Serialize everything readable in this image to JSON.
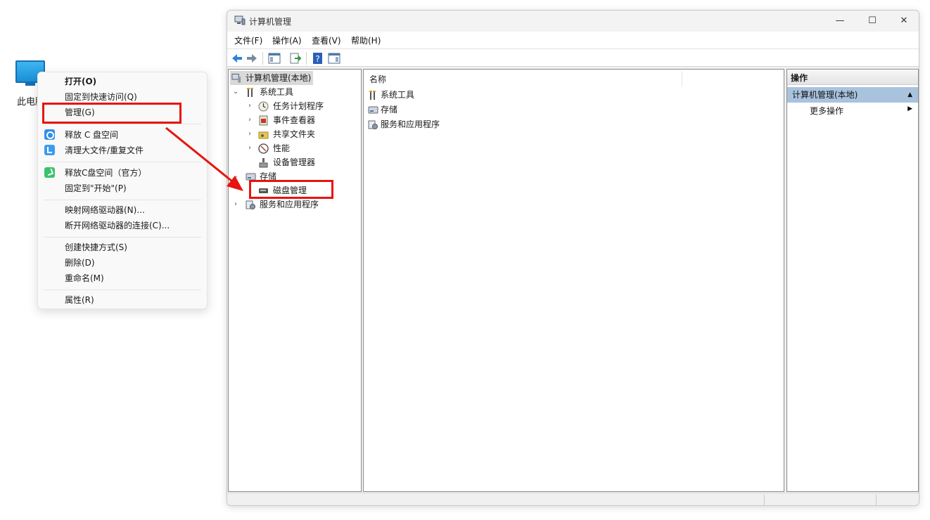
{
  "desktop": {
    "icon_label": "此电脑"
  },
  "context_menu": {
    "items": [
      {
        "label": "打开(O)",
        "bold": true
      },
      {
        "label": "固定到快速访问(Q)"
      },
      {
        "label": "管理(G)"
      },
      {
        "label": "释放 C 盘空间",
        "icon": "magnifier-app-icon"
      },
      {
        "label": "清理大文件/重复文件",
        "icon": "clock-app-icon"
      },
      {
        "label": "释放C盘空间（官方）",
        "icon": "broom-app-icon"
      },
      {
        "label": "固定到\"开始\"(P)"
      },
      {
        "label": "映射网络驱动器(N)..."
      },
      {
        "label": "断开网络驱动器的连接(C)..."
      },
      {
        "label": "创建快捷方式(S)"
      },
      {
        "label": "删除(D)"
      },
      {
        "label": "重命名(M)"
      },
      {
        "label": "属性(R)"
      }
    ]
  },
  "window": {
    "title": "计算机管理",
    "controls": {
      "minimize": "—",
      "maximize": "☐",
      "close": "✕"
    },
    "menu": [
      "文件(F)",
      "操作(A)",
      "查看(V)",
      "帮助(H)"
    ],
    "tree": {
      "root": "计算机管理(本地)",
      "system_tools": "系统工具",
      "task_scheduler": "任务计划程序",
      "event_viewer": "事件查看器",
      "shared_folders": "共享文件夹",
      "performance": "性能",
      "device_manager": "设备管理器",
      "storage": "存储",
      "disk_management": "磁盘管理",
      "services_apps": "服务和应用程序"
    },
    "list": {
      "column_name": "名称",
      "rows": [
        "系统工具",
        "存储",
        "服务和应用程序"
      ]
    },
    "actions": {
      "header": "操作",
      "selected": "计算机管理(本地)",
      "more": "更多操作"
    }
  },
  "colors": {
    "highlight_red": "#e8140f",
    "action_selected": "#a9c3de"
  }
}
